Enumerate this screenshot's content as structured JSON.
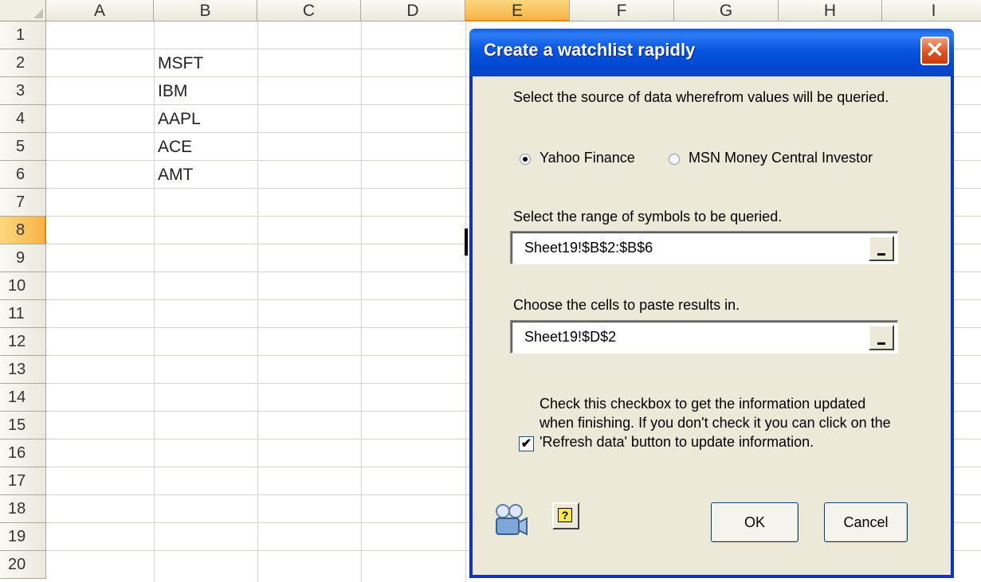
{
  "spreadsheet": {
    "columns": [
      "A",
      "B",
      "C",
      "D",
      "E",
      "F",
      "G",
      "H",
      "I"
    ],
    "selected_column": "E",
    "rows": [
      "1",
      "2",
      "3",
      "4",
      "5",
      "6",
      "7",
      "8",
      "9",
      "10",
      "11",
      "12",
      "13",
      "14",
      "15",
      "16",
      "17",
      "18",
      "19",
      "20"
    ],
    "selected_row": "8",
    "cells": {
      "B2": "MSFT",
      "B3": "IBM",
      "B4": "AAPL",
      "B5": "ACE",
      "B6": "AMT"
    }
  },
  "dialog": {
    "title": "Create a watchlist rapidly",
    "source_label": "Select the source of data wherefrom values will be queried.",
    "sources": [
      {
        "label": "Yahoo Finance",
        "selected": true
      },
      {
        "label": "MSN Money Central Investor",
        "selected": false
      }
    ],
    "range_label": "Select the range of symbols to be queried.",
    "range_value": "Sheet19!$B$2:$B$6",
    "paste_label": "Choose the cells to paste results in.",
    "paste_value": "Sheet19!$D$2",
    "update_checkbox": {
      "checked": true,
      "label": "Check this checkbox to get the information updated when finishing. If you don't check it you can click on the 'Refresh data' button to update information."
    },
    "help_glyph": "?",
    "ok_label": "OK",
    "cancel_label": "Cancel",
    "close_glyph": "✕"
  },
  "icons": [
    "close-icon",
    "video-camera-icon",
    "help-icon",
    "range-select-icon"
  ]
}
